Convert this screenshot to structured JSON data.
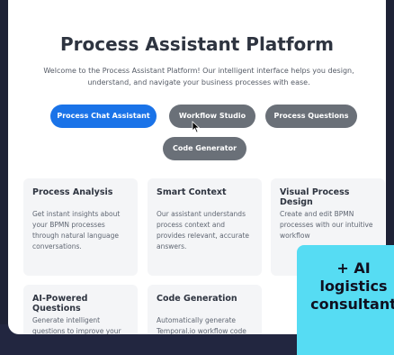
{
  "page": {
    "title": "Process Assistant Platform",
    "subtitle": "Welcome to the Process Assistant Platform! Our intelligent interface helps you design, understand, and navigate your business processes with ease."
  },
  "nav": {
    "buttons": [
      {
        "label": "Process Chat Assistant",
        "active": true
      },
      {
        "label": "Workflow Studio",
        "active": false
      },
      {
        "label": "Process Questions",
        "active": false
      },
      {
        "label": "Code Generator",
        "active": false
      }
    ]
  },
  "features": [
    {
      "title": "Process Analysis",
      "description": "Get instant insights about your BPMN processes through natural language conversations."
    },
    {
      "title": "Smart Context",
      "description": "Our assistant understands process context and provides relevant, accurate answers."
    },
    {
      "title": "Visual Process Design",
      "description": "Create and edit BPMN processes with our intuitive workflow"
    },
    {
      "title": "AI-Powered Questions",
      "description": "Generate intelligent questions to improve your"
    },
    {
      "title": "Code Generation",
      "description": "Automatically generate Temporal.io workflow code"
    }
  ],
  "overlay": {
    "text": "+ AI\nlogistics\nconsultant"
  },
  "colors": {
    "primary": "#1a73e8",
    "secondary": "#6a7078",
    "overlay": "#56dcf3",
    "background": "#1e2236"
  },
  "icons": {
    "cursor": "mouse-pointer-icon"
  }
}
